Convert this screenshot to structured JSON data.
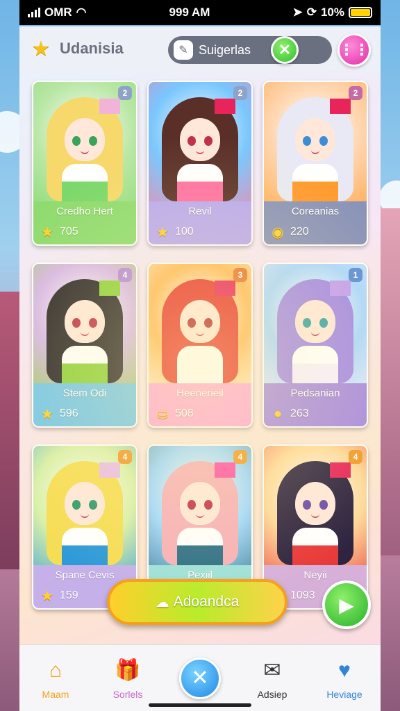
{
  "status_bar": {
    "carrier": "OMR",
    "time": "999 AM",
    "battery_text": "10%"
  },
  "header": {
    "title": "Udanisia",
    "suggestion_label": "Suigerlas"
  },
  "cards": [
    {
      "name": "Credho Hert",
      "score": "705",
      "badge": "2",
      "score_icon": "star-icon",
      "hair": "#f6d86b",
      "accent": "#7ad86a",
      "eyes": "#3aa35a",
      "info_bg": "#8edb6f",
      "bow": "#f1b4d8",
      "art_bg": "#b9e7a5",
      "badge_bg": "#8fa3c8"
    },
    {
      "name": "Revil",
      "score": "100",
      "badge": "2",
      "score_icon": "star-icon",
      "hair": "#5a2f28",
      "accent": "#ff6fa3",
      "eyes": "#c0304a",
      "info_bg": "#b9a8f0",
      "bow": "#e8245a",
      "art_bg": "#79c6ff",
      "badge_bg": "#8fa3c8"
    },
    {
      "name": "Coreanias",
      "score": "220",
      "badge": "2",
      "score_icon": "donut-icon",
      "hair": "#e8e9f4",
      "accent": "#ff9a2e",
      "eyes": "#3b8ed6",
      "info_bg": "#8a93b8",
      "bow": "#e8245a",
      "art_bg": "#ffd2a8",
      "badge_bg": "#c56aa4"
    },
    {
      "name": "Stem Odi",
      "score": "596",
      "badge": "4",
      "score_icon": "star-icon",
      "hair": "#2e2a2b",
      "accent": "#8fd13c",
      "eyes": "#c0304a",
      "info_bg": "#77c7e8",
      "bow": "#8fd13c",
      "art_bg": "#d7b7e8",
      "badge_bg": "#b58ad8"
    },
    {
      "name": "Heenerieil",
      "score": "508",
      "badge": "3",
      "score_icon": "pot-icon",
      "hair": "#e8342c",
      "accent": "#ffffff",
      "eyes": "#b6262e",
      "info_bg": "#ffa8d6",
      "bow": "#e8245a",
      "art_bg": "#ffb85a",
      "badge_bg": "#e8742c"
    },
    {
      "name": "Pedsanian",
      "score": "263",
      "badge": "1",
      "score_icon": "coin-icon",
      "hair": "#a48ae6",
      "accent": "#f6f0ff",
      "eyes": "#3aa3a8",
      "info_bg": "#a88ae0",
      "bow": "#c29ef0",
      "art_bg": "#a9d6ff",
      "badge_bg": "#5b8ed6"
    },
    {
      "name": "Spane Cevis",
      "score": "159",
      "badge": "4",
      "score_icon": "star-icon",
      "hair": "#f6dd56",
      "accent": "#2f9ad8",
      "eyes": "#2f9a6a",
      "info_bg": "#c6b0ea",
      "bow": "#e9bde6",
      "art_bg": "#d9f0a8",
      "badge_bg": "#f09a2a"
    },
    {
      "name": "Pexiil",
      "score": "",
      "badge": "4",
      "score_icon": "",
      "hair": "#f7b0b8",
      "accent": "#2c6f86",
      "eyes": "#c0304a",
      "info_bg": "#9fe0d8",
      "bow": "#ff4fa6",
      "art_bg": "#9fd7ff",
      "badge_bg": "#f09a2a"
    },
    {
      "name": "Neyii",
      "score": "1093",
      "badge": "4",
      "score_icon": "",
      "hair": "#2f2440",
      "accent": "#e83a3a",
      "eyes": "#6a4aa8",
      "info_bg": "#d7b0d9",
      "bow": "#e8245a",
      "art_bg": "#ffd89a",
      "badge_bg": "#f09a2a"
    }
  ],
  "cta": {
    "label": "Adoandca"
  },
  "nav": {
    "items": [
      {
        "label": "Maam",
        "icon": "home-icon",
        "color": "#f0a21a"
      },
      {
        "label": "Sorlels",
        "icon": "gift-icon",
        "color": "#c768c9"
      },
      {
        "label": "",
        "icon": "close-icon",
        "color": "#1e88e5"
      },
      {
        "label": "Adsiep",
        "icon": "message-icon",
        "color": "#333333"
      },
      {
        "label": "Heviage",
        "icon": "heart-icon",
        "color": "#2f86d6"
      }
    ]
  },
  "colors": {
    "accent_green": "#2fbf2f",
    "accent_pink": "#e42ba9",
    "cta_yellow": "#ffcf2c"
  }
}
